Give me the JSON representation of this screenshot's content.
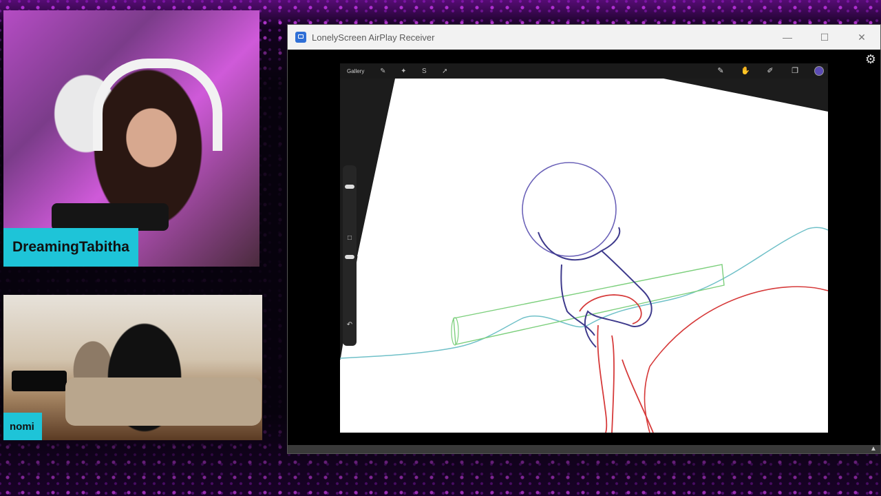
{
  "stream": {
    "participants": [
      {
        "name": "DreamingTabitha"
      },
      {
        "name": "nomi"
      }
    ]
  },
  "window": {
    "title": "LonelyScreen AirPlay Receiver",
    "controls": {
      "minimize": "—",
      "maximize": "☐",
      "close": "✕"
    }
  },
  "procreate": {
    "gallery_label": "Gallery",
    "active_color": "#5b4bb3"
  },
  "colors": {
    "name_tag": "#1ec4d8",
    "sketch_blue": "#5b4bb3",
    "sketch_red": "#d63a3a",
    "sketch_green": "#7ccf7c",
    "sketch_teal": "#6fc0c8"
  }
}
